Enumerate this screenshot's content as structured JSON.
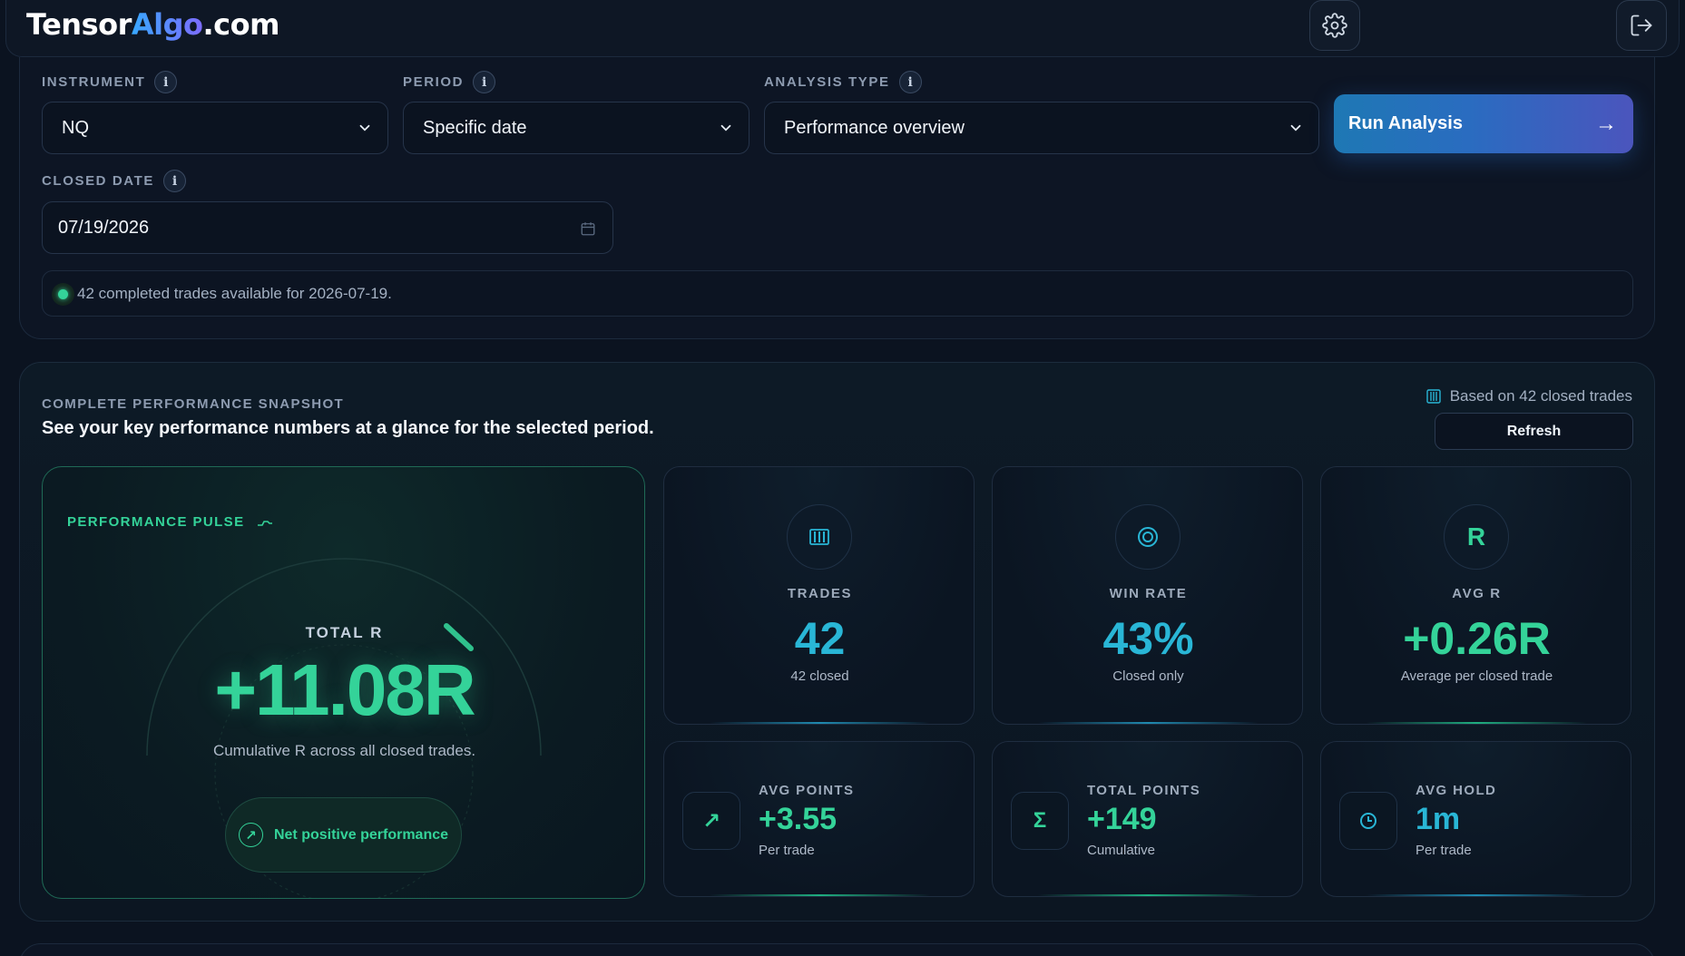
{
  "brand": {
    "part1": "Tensor",
    "part2": "Algo",
    "part3": ".com"
  },
  "header": {
    "settings_icon": "gear-icon",
    "logout_icon": "logout-icon"
  },
  "filters": {
    "instrument": {
      "label": "INSTRUMENT",
      "value": "NQ"
    },
    "period": {
      "label": "PERIOD",
      "value": "Specific date"
    },
    "analysis_type": {
      "label": "ANALYSIS TYPE",
      "value": "Performance overview"
    },
    "run_button": "Run Analysis",
    "run_arrow": "→",
    "closed_date": {
      "label": "CLOSED DATE",
      "value": "07/19/2026"
    },
    "info_glyph": "i",
    "notice": "42 completed trades available for 2026-07-19."
  },
  "snapshot": {
    "eyebrow": "COMPLETE PERFORMANCE SNAPSHOT",
    "title": "See your key performance numbers at a glance for the selected period.",
    "based_on": "Based on 42 closed trades",
    "refresh": "Refresh",
    "pulse": {
      "label": "PERFORMANCE PULSE",
      "total_label": "TOTAL R",
      "total_value": "+11.08R",
      "total_sub": "Cumulative R across all closed trades.",
      "status": "Net positive performance",
      "status_arrow": "↗"
    },
    "stats": [
      {
        "label": "TRADES",
        "value": "42",
        "sub": "42 closed",
        "icon": "bars-icon"
      },
      {
        "label": "WIN RATE",
        "value": "43%",
        "sub": "Closed only",
        "icon": "target-icon"
      },
      {
        "label": "AVG R",
        "value": "+0.26R",
        "sub": "Average per closed trade",
        "icon": "r-icon",
        "icon_glyph": "R"
      }
    ],
    "minis": [
      {
        "label": "AVG POINTS",
        "value": "+3.55",
        "sub": "Per trade",
        "icon": "trend-up-icon",
        "icon_glyph": "↗"
      },
      {
        "label": "TOTAL POINTS",
        "value": "+149",
        "sub": "Cumulative",
        "icon": "sigma-icon",
        "icon_glyph": "Σ"
      },
      {
        "label": "AVG HOLD",
        "value": "1m",
        "sub": "Per trade",
        "icon": "clock-icon"
      }
    ]
  },
  "colors": {
    "accent_green": "#34d399",
    "accent_cyan": "#29b6d6",
    "background": "#0b1320"
  }
}
